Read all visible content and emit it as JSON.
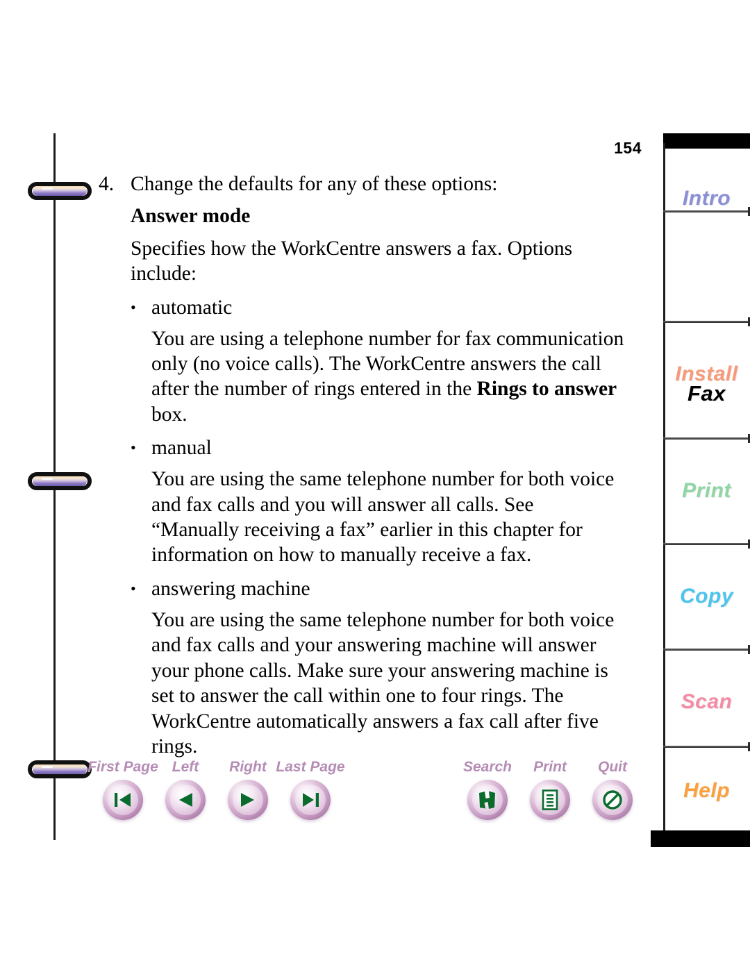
{
  "page": {
    "number": "154"
  },
  "content": {
    "step": {
      "number": "4.",
      "text": "Change the defaults for any of these options:"
    },
    "heading": "Answer mode",
    "intro": "Specifies how the WorkCentre answers a fax. Options include:",
    "bullet_mark": "•",
    "options": [
      {
        "label": "automatic",
        "body_pre": "You are using a telephone number for fax communication only (no voice calls). The WorkCentre answers the call after the number of rings entered in the ",
        "body_bold": "Rings to answer",
        "body_post": " box."
      },
      {
        "label": "manual",
        "body_pre": "You are using the same telephone number for both voice and fax calls and you will answer all calls. See “Manually receiving a fax” earlier in this chapter for information on how to manually receive a fax.",
        "body_bold": "",
        "body_post": ""
      },
      {
        "label": "answering machine",
        "body_pre": "You are using the same telephone number for both voice and fax calls and your answering machine will answer your phone calls. Make sure your answering machine is set to answer the call within one to four rings. The WorkCentre automatically answers a fax call after five rings.",
        "body_bold": "",
        "body_post": ""
      }
    ]
  },
  "nav": {
    "left_group": [
      {
        "label": "First Page",
        "icon": "first-page-icon"
      },
      {
        "label": "Left",
        "icon": "previous-page-icon"
      },
      {
        "label": "Right",
        "icon": "next-page-icon"
      },
      {
        "label": "Last Page",
        "icon": "last-page-icon"
      }
    ],
    "right_group": [
      {
        "label": "Search",
        "icon": "search-icon"
      },
      {
        "label": "Print",
        "icon": "print-icon"
      },
      {
        "label": "Quit",
        "icon": "quit-icon"
      }
    ],
    "label_color": "#b58cb4",
    "glyph_color": "#0a6b2d"
  },
  "tabs": [
    {
      "label": "Intro",
      "color": "#8a8fd6",
      "active": false
    },
    {
      "label": "Install",
      "color": "#f79a7a",
      "active": false
    },
    {
      "label": "Fax",
      "color": "#000000",
      "active": true
    },
    {
      "label": "Print",
      "color": "#8fd6a4",
      "active": false
    },
    {
      "label": "Copy",
      "color": "#4cc5ee",
      "active": false
    },
    {
      "label": "Scan",
      "color": "#f58ba4",
      "active": false
    },
    {
      "label": "Help",
      "color": "#fba03c",
      "active": false
    }
  ]
}
